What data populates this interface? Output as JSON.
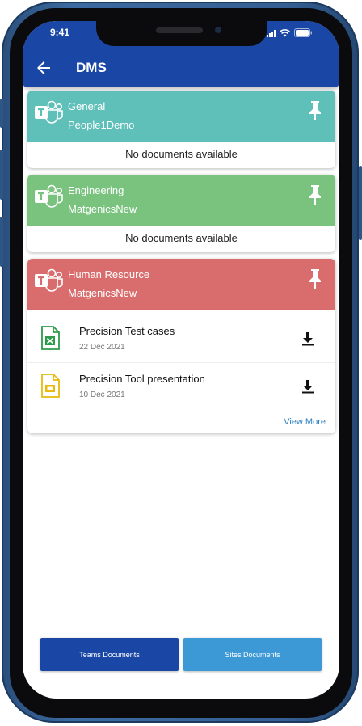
{
  "status_bar": {
    "time": "9:41"
  },
  "header": {
    "title": "DMS"
  },
  "colors": {
    "appbar": "#1a47a6",
    "general": "#5fbfb9",
    "engineering": "#79c37f",
    "human_resource": "#d96c6c",
    "teams_button": "#1a47a6",
    "sites_button": "#3d98d6",
    "view_more": "#2d7fc1"
  },
  "channels": [
    {
      "name": "General",
      "team": "People1Demo",
      "empty_text": "No documents available"
    },
    {
      "name": "Engineering",
      "team": "MatgenicsNew",
      "empty_text": "No documents available"
    },
    {
      "name": "Human Resource",
      "team": "MatgenicsNew",
      "documents": [
        {
          "title": "Precision Test cases",
          "date": "22 Dec 2021",
          "icon": "excel-file-icon"
        },
        {
          "title": "Precision Tool presentation",
          "date": "10 Dec 2021",
          "icon": "slides-file-icon"
        }
      ],
      "view_more": "View More"
    }
  ],
  "bottom_buttons": {
    "teams": "Teams Documents",
    "sites": "Sites Documents"
  }
}
